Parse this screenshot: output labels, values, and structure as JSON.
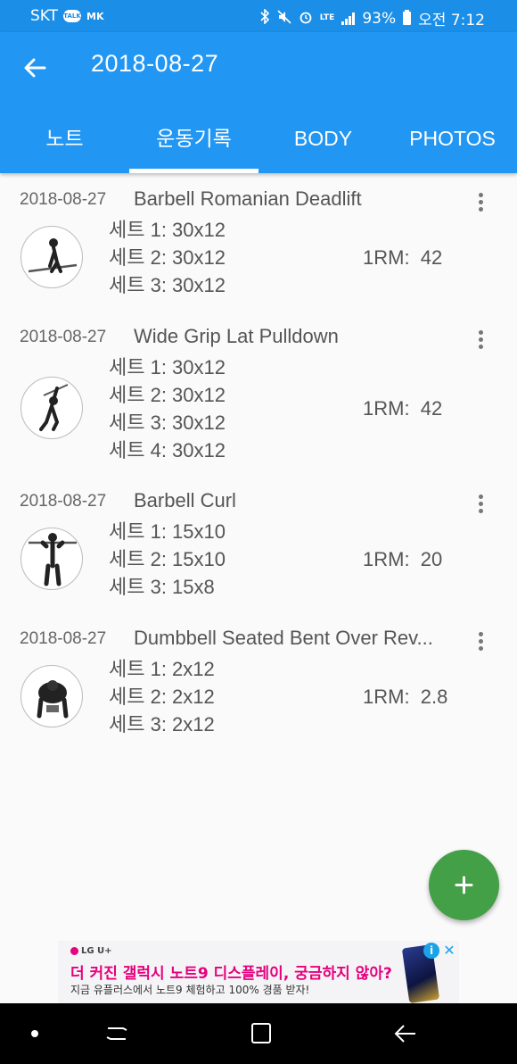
{
  "status_bar": {
    "carrier": "SKT",
    "talk_badge": "TALK",
    "mk_badge": "MK",
    "lte": "LTE",
    "battery": "93%",
    "time": "오전 7:12"
  },
  "app_bar": {
    "title": "2018-08-27"
  },
  "tabs": [
    {
      "label": "노트",
      "active": false
    },
    {
      "label": "운동기록",
      "active": true
    },
    {
      "label": "BODY",
      "active": false
    },
    {
      "label": "PHOTOS",
      "active": false
    }
  ],
  "workouts": [
    {
      "date": "2018-08-27",
      "name": "Barbell Romanian Deadlift",
      "sets": [
        "세트 1: 30x12",
        "세트 2: 30x12",
        "세트 3: 30x12"
      ],
      "one_rm_label": "1RM:",
      "one_rm_value": "42"
    },
    {
      "date": "2018-08-27",
      "name": "Wide Grip Lat Pulldown",
      "sets": [
        "세트 1: 30x12",
        "세트 2: 30x12",
        "세트 3: 30x12",
        "세트 4: 30x12"
      ],
      "one_rm_label": "1RM:",
      "one_rm_value": "42"
    },
    {
      "date": "2018-08-27",
      "name": "Barbell Curl",
      "sets": [
        "세트 1: 15x10",
        "세트 2: 15x10",
        "세트 3: 15x8"
      ],
      "one_rm_label": "1RM:",
      "one_rm_value": "20"
    },
    {
      "date": "2018-08-27",
      "name": "Dumbbell Seated Bent Over Rev...",
      "sets": [
        "세트 1: 2x12",
        "세트 2: 2x12",
        "세트 3: 2x12"
      ],
      "one_rm_label": "1RM:",
      "one_rm_value": "2.8"
    }
  ],
  "ad": {
    "brand": "LG U+",
    "headline": "더 커진 갤럭시 노트9 디스플레이, 궁금하지 않아?",
    "sub": "지금 유플러스에서 노트9 체험하고 100% 경품 받자!"
  },
  "colors": {
    "primary": "#2196f3",
    "status_bar": "#1b8ee8",
    "fab": "#43a047",
    "ad_accent": "#e6007e"
  },
  "icons": {
    "back": "arrow-left-icon",
    "more": "more-vertical-icon",
    "fab": "plus-icon"
  }
}
